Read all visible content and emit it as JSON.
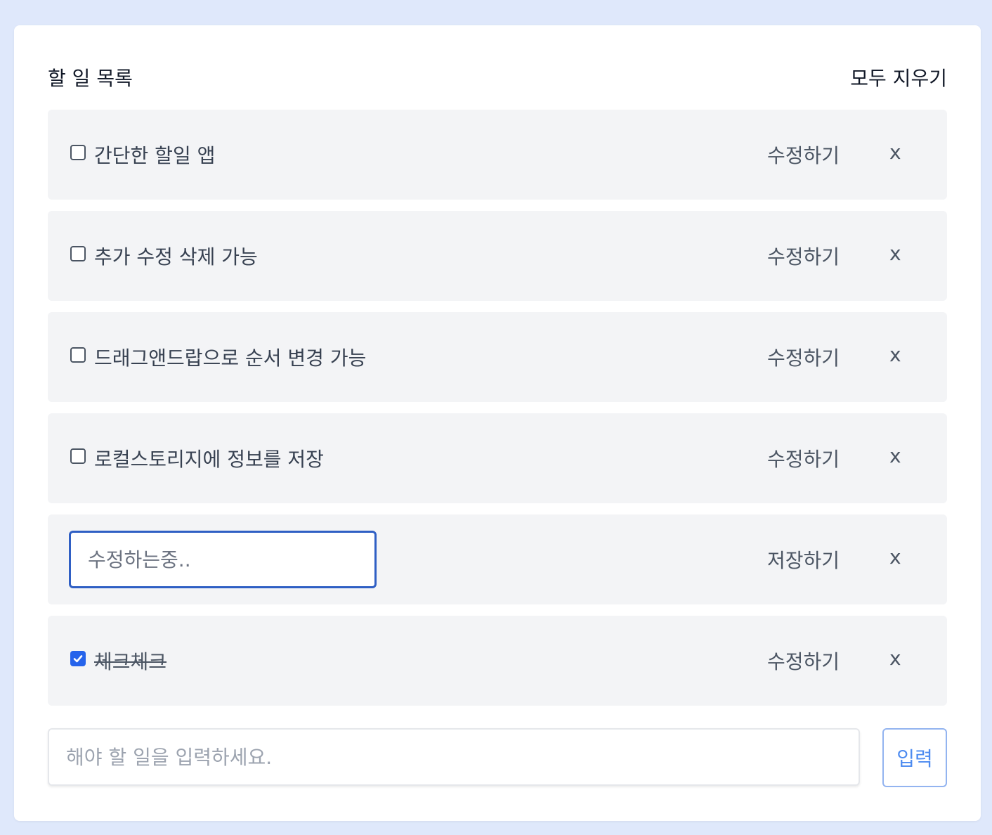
{
  "header": {
    "title": "할 일 목록",
    "clear_all_label": "모두 지우기"
  },
  "todos": [
    {
      "text": "간단한 할일 앱",
      "checked": false,
      "action_label": "수정하기",
      "delete_label": "x"
    },
    {
      "text": "추가 수정 삭제 가능",
      "checked": false,
      "action_label": "수정하기",
      "delete_label": "x"
    },
    {
      "text": "드래그앤드랍으로 순서 변경 가능",
      "checked": false,
      "action_label": "수정하기",
      "delete_label": "x"
    },
    {
      "text": "로컬스토리지에 정보를 저장",
      "checked": false,
      "action_label": "수정하기",
      "delete_label": "x"
    },
    {
      "editing": true,
      "edit_placeholder": "수정하는중..",
      "edit_value": "",
      "action_label": "저장하기",
      "delete_label": "x"
    },
    {
      "text": "체크체크",
      "checked": true,
      "action_label": "수정하기",
      "delete_label": "x"
    }
  ],
  "new_todo": {
    "placeholder": "해야 할 일을 입력하세요.",
    "value": "",
    "submit_label": "입력"
  },
  "colors": {
    "background": "#dfe8fb",
    "item_background": "#f3f4f6",
    "accent": "#2563eb",
    "submit_text": "#4d8bf0"
  }
}
